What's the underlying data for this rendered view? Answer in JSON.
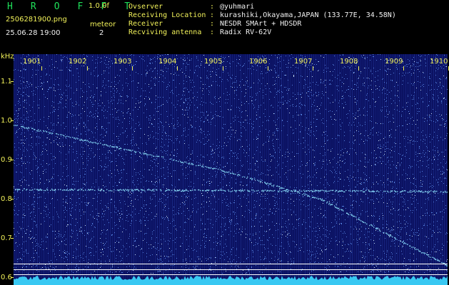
{
  "header": {
    "brand": "H R O F F T",
    "version": "1.0.0f",
    "file_name": "2506281900.png",
    "datetime": "25.06.28 19:00",
    "meteor_label": "meteor",
    "meteor_count": "2",
    "info": [
      {
        "key": "Ovserver",
        "sep": ":",
        "value": "@yuhmari"
      },
      {
        "key": "Receiving Location",
        "sep": ":",
        "value": "kurashiki,Okayama,JAPAN (133.77E, 34.58N)"
      },
      {
        "key": "Receiver",
        "sep": ":",
        "value": "NESDR SMArt + HDSDR"
      },
      {
        "key": "Recviving antenna",
        "sep": ":",
        "value": "Radix RV-62V"
      }
    ]
  },
  "chart_data": {
    "type": "heatmap",
    "y_unit_label": "kHz",
    "y_ticks": [
      "1.1",
      "1.0",
      "0.9",
      "0.8",
      "0.7",
      "0.6"
    ],
    "x_ticks": [
      "1901",
      "1902",
      "1903",
      "1904",
      "1905",
      "1906",
      "1907",
      "1908",
      "1909",
      "1910"
    ],
    "ylim": [
      0.58,
      1.17
    ],
    "xlim": [
      1900.6,
      1910.2
    ],
    "colors": {
      "background": "#0b1262",
      "noise": "#6aa0ff",
      "trace": "#8fe6ff",
      "axis": "#f2f25a"
    }
  }
}
